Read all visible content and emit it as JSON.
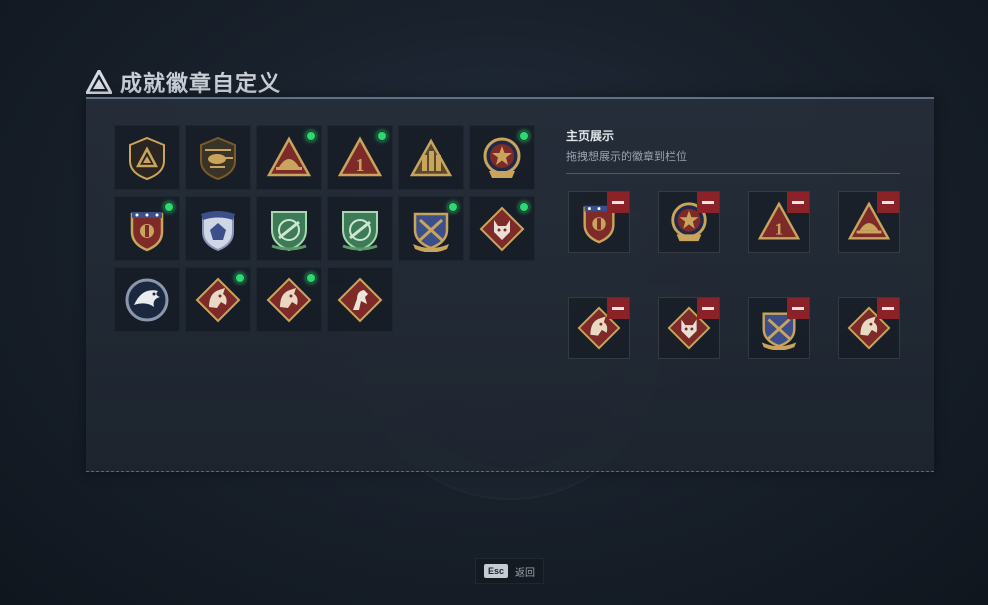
{
  "header": {
    "title": "成就徽章自定义",
    "icon": "delta-triangle-icon"
  },
  "showcase": {
    "title": "主页展示",
    "subtitle": "拖拽想展示的徽章到栏位"
  },
  "badges": [
    {
      "icon": "delta-shield-badge",
      "new": false
    },
    {
      "icon": "helicopter-badge",
      "new": false
    },
    {
      "icon": "helmet-triangle-badge",
      "new": true
    },
    {
      "icon": "number-one-triangle-badge",
      "new": true
    },
    {
      "icon": "soldiers-triangle-badge",
      "new": false
    },
    {
      "icon": "star-medallion-badge",
      "new": true
    },
    {
      "icon": "crest-stars-badge",
      "new": true
    },
    {
      "icon": "blue-crest-badge",
      "new": false
    },
    {
      "icon": "green-rifle-shield-badge",
      "new": false
    },
    {
      "icon": "green-rifle-shield-badge-2",
      "new": false
    },
    {
      "icon": "crossed-weapons-shield-badge",
      "new": true
    },
    {
      "icon": "wolf-diamond-badge",
      "new": true
    },
    {
      "icon": "eagle-round-badge",
      "new": false
    },
    {
      "icon": "dragon-diamond-badge",
      "new": true
    },
    {
      "icon": "dragon-diamond-badge-2",
      "new": true
    },
    {
      "icon": "horse-diamond-badge",
      "new": false
    }
  ],
  "slots": [
    {
      "icon": "crest-stars-badge"
    },
    {
      "icon": "star-medallion-badge"
    },
    {
      "icon": "number-one-triangle-badge"
    },
    {
      "icon": "helmet-triangle-badge"
    },
    {
      "icon": "dragon-diamond-badge"
    },
    {
      "icon": "wolf-diamond-badge"
    },
    {
      "icon": "crossed-weapons-shield-badge"
    },
    {
      "icon": "dragon-diamond-badge-2"
    }
  ],
  "footer": {
    "key": "Esc",
    "label": "返回"
  },
  "colors": {
    "accent_border": "#5f7186",
    "new_indicator": "#2fd874",
    "remove": "#8a2228",
    "gold": "#c9a45c"
  }
}
